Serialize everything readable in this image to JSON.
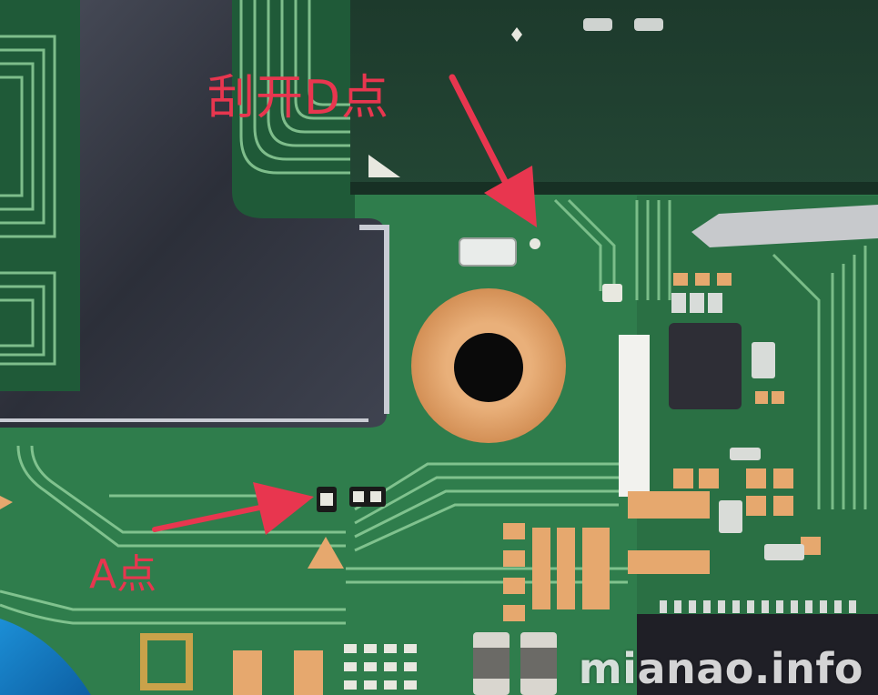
{
  "annotations": {
    "d_point_label": "刮开D点",
    "a_point_label": "A点"
  },
  "watermark": "mianao.info",
  "colors": {
    "board_green": "#2f7d4c",
    "trace_green": "#8fcf9a",
    "annotation_red": "#e8364f",
    "copper_pad": "#e6a86e",
    "shield_metal": "#3a3e4a"
  }
}
